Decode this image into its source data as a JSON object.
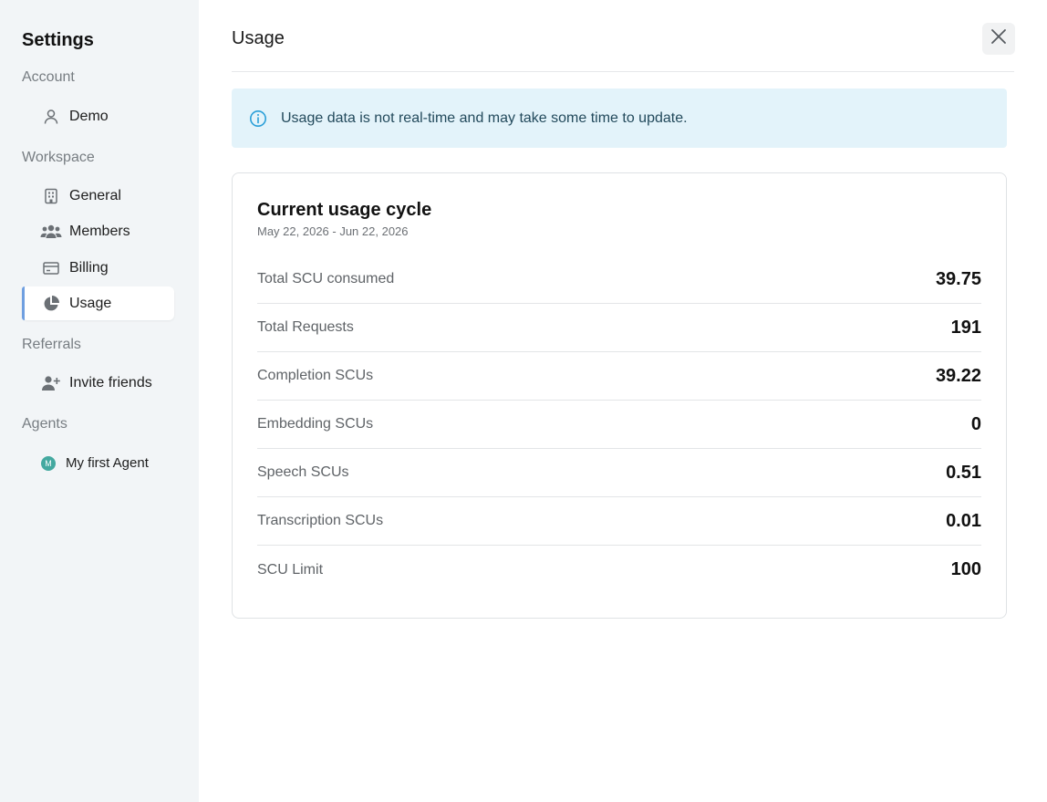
{
  "sidebar": {
    "title": "Settings",
    "sections": {
      "account": "Account",
      "workspace": "Workspace",
      "referrals": "Referrals",
      "agents": "Agents"
    },
    "items": {
      "demo": "Demo",
      "general": "General",
      "members": "Members",
      "billing": "Billing",
      "usage": "Usage",
      "invite": "Invite friends",
      "agent": "My first Agent",
      "agent_initial": "M"
    }
  },
  "main": {
    "title": "Usage",
    "banner": "Usage data is not real-time and may take some time to update.",
    "card": {
      "title": "Current usage cycle",
      "period": "May 22, 2026 - Jun 22, 2026",
      "rows": [
        {
          "label": "Total SCU consumed",
          "value": "39.75"
        },
        {
          "label": "Total Requests",
          "value": "191"
        },
        {
          "label": "Completion SCUs",
          "value": "39.22"
        },
        {
          "label": "Embedding SCUs",
          "value": "0"
        },
        {
          "label": "Speech SCUs",
          "value": "0.51"
        },
        {
          "label": "Transcription SCUs",
          "value": "0.01"
        },
        {
          "label": "SCU Limit",
          "value": "100"
        }
      ]
    }
  },
  "colors": {
    "sidebar_bg": "#f2f5f7",
    "active_accent": "#6f9fe0",
    "banner_bg": "#e3f3fa",
    "info_icon": "#2a9fd8",
    "agent_avatar": "#44a9a0"
  },
  "icons": {
    "demo": "user-icon",
    "general": "building-icon",
    "members": "users-icon",
    "billing": "credit-card-icon",
    "usage": "pie-chart-icon",
    "invite": "user-plus-icon",
    "close": "close-icon",
    "info": "info-icon"
  }
}
